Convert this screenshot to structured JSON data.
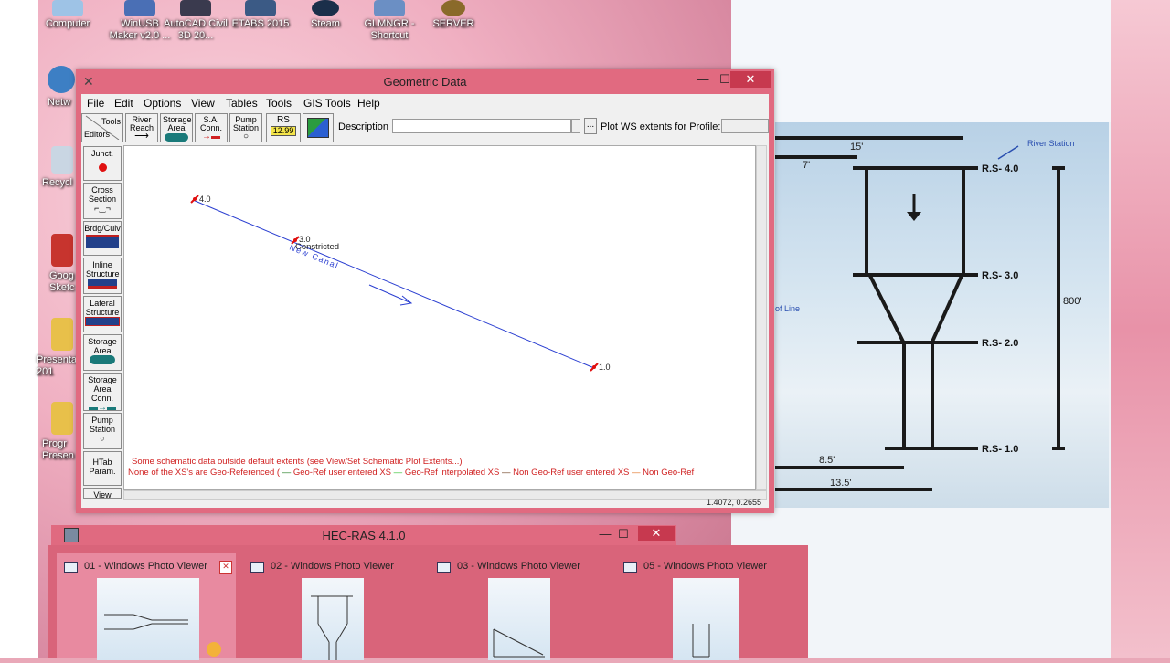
{
  "desktop": {
    "icons": [
      {
        "label": "Computer"
      },
      {
        "label": "WinUSB Maker v2.0 ..."
      },
      {
        "label": "AutoCAD Civil 3D 20..."
      },
      {
        "label": "ETABS 2015"
      },
      {
        "label": "Steam"
      },
      {
        "label": "GLMNGR - Shortcut"
      },
      {
        "label": "SERVER"
      },
      {
        "label": "Netw"
      },
      {
        "label": "Recycl"
      },
      {
        "label": "Goog Sketc"
      },
      {
        "label": "Presentat 201"
      },
      {
        "label": "Progr Presen"
      }
    ]
  },
  "geo_window": {
    "title": "Geometric Data",
    "menu": [
      "File",
      "Edit",
      "Options",
      "View",
      "Tables",
      "Tools",
      "GIS Tools",
      "Help"
    ],
    "toolbar": {
      "tools_label": "Tools",
      "editors_label": "Editors",
      "river_reach": "River Reach",
      "storage_area": "Storage Area",
      "sa_conn": "S.A. Conn.",
      "pump_station": "Pump Station",
      "rs": "RS",
      "rs_value": "12.99",
      "description_label": "Description :",
      "description_value": "",
      "ellipsis": "...",
      "plot_ws_label": "Plot WS extents for Profile:",
      "plot_ws_value": ""
    },
    "editors": [
      "Junct.",
      "Cross Section",
      "Brdg/Culv",
      "Inline Structure",
      "Lateral Structure",
      "Storage Area",
      "Storage Area Conn.",
      "Pump Station",
      "HTab Param.",
      "View"
    ],
    "schematic": {
      "stations": [
        "4.0",
        "3.0",
        "1.0"
      ],
      "reach_label": "Constricted",
      "river_label": "New Canal",
      "warning": "Some schematic data outside default extents (see View/Set Schematic Plot Extents...)",
      "legend": {
        "lead": "None of the XS's are Geo-Referenced (",
        "items": [
          "Geo-Ref user entered XS",
          "Geo-Ref interpolated XS",
          "Non Geo-Ref user entered XS",
          "Non Geo-Ref"
        ]
      }
    },
    "status_coords": "1.4072, 0.2655",
    "colors": {
      "reach": "#2b3fd1",
      "node": "#e01010",
      "warning": "#d02020"
    }
  },
  "hec_window": {
    "title": "HEC-RAS 4.1.0"
  },
  "taskbar_previews": [
    {
      "label": "01 - Windows Photo Viewer"
    },
    {
      "label": "02 - Windows Photo Viewer"
    },
    {
      "label": "03 - Windows Photo Viewer"
    },
    {
      "label": "05 - Windows Photo Viewer"
    }
  ],
  "photo": {
    "dim_15": "15'",
    "dim_7": "7'",
    "river_station": "River Station",
    "rs40": "R.S- 4.0",
    "rs30": "R.S- 3.0",
    "rs20": "R.S- 2.0",
    "rs10": "R.S- 1.0",
    "len_800": "800'",
    "of_line": "of Line",
    "dim_85": "8.5'",
    "dim_135": "13.5'"
  }
}
